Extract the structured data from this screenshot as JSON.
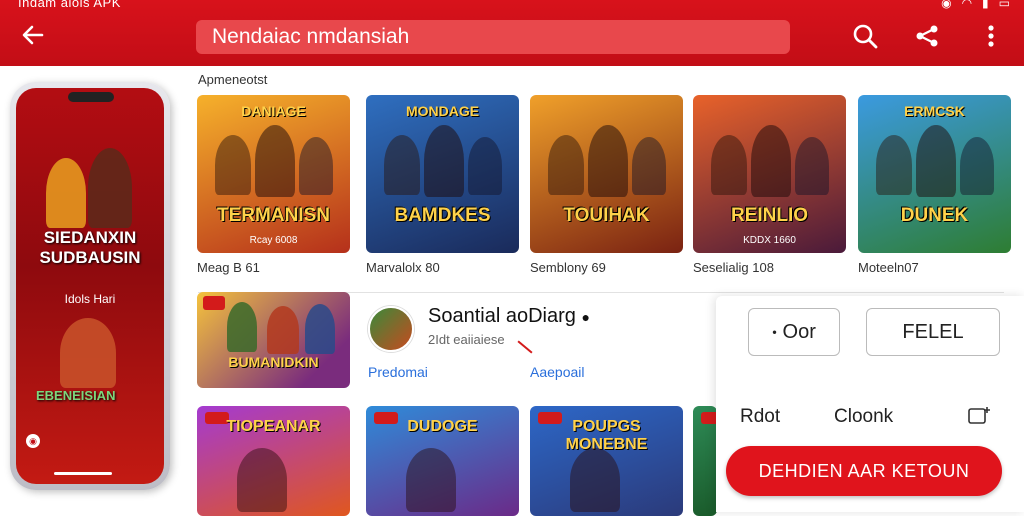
{
  "statusbar": {
    "title": "Indam aiois APK",
    "suffix": "APK"
  },
  "topbar": {
    "search_text": "Nendaiac nmdansiah",
    "icons": [
      "back-arrow-icon",
      "search-icon",
      "share-icon",
      "more-vertical-icon"
    ]
  },
  "phone": {
    "title": "SIEDANXIN SUDBAUSIN",
    "subtitle": "Idols Hari",
    "bottom_title": "EBENEISIAN"
  },
  "section": {
    "title": "Apmeneotst"
  },
  "games_row1": [
    {
      "logo": "DANIAGE",
      "name": "TERMANISN",
      "tag": "Rcay 6008",
      "caption": "Meag B 61",
      "colors": [
        "#f6b12b",
        "#b5301b"
      ]
    },
    {
      "logo": "MONDAGE",
      "name": "BAMDKES",
      "tag": "",
      "caption": "Marvalolx 80",
      "colors": [
        "#2f6fc0",
        "#1a2a5a"
      ]
    },
    {
      "logo": "",
      "name": "TOUIHAK",
      "tag": "",
      "caption": "Semblony 69",
      "colors": [
        "#f0a02a",
        "#7a2212"
      ]
    },
    {
      "logo": "",
      "name": "REINLIO",
      "tag": "KDDX 1660",
      "caption": "Seselialig 108",
      "colors": [
        "#e8622a",
        "#4a1a3a"
      ]
    },
    {
      "logo": "ERMCSK",
      "name": "DUNEK",
      "tag": "",
      "caption": "Moteeln07",
      "colors": [
        "#3b9ae0",
        "#2e7d32"
      ]
    }
  ],
  "featured": {
    "card_name": "BUMANIDKIN",
    "app_name": "Soantial aoDiarg",
    "verified_mark": "●",
    "meta": "2Idt eaiiaiese",
    "link_left": "Predomai",
    "link_right": "Aaepoail"
  },
  "panel": {
    "button_left": "Oor",
    "button_right": "FELEL",
    "label_left": "Rdot",
    "label_right": "Cloonk",
    "cta": "DEHDIEN AAR KETOUN"
  },
  "games_row3": [
    {
      "logo": "TIOPEANAR",
      "colors": [
        "#a43ad1",
        "#e0571e"
      ]
    },
    {
      "logo": "DUDOGE",
      "colors": [
        "#2f8bd9",
        "#6b2a88"
      ]
    },
    {
      "logo": "POUPGS MONEBNE",
      "colors": [
        "#2d67c7",
        "#2b3a7a"
      ]
    },
    {
      "logo": "",
      "colors": [
        "#2e8b57",
        "#1a5a2a"
      ]
    }
  ]
}
